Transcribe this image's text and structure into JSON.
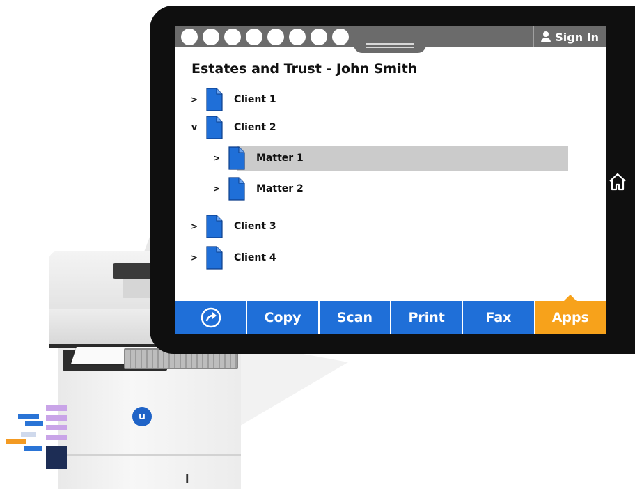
{
  "colors": {
    "accent": "#1f6fd8",
    "active_tab": "#f7a21b",
    "status_bar": "#6b6b6b",
    "selection": "#cbcbcb",
    "tablet_frame": "#0f0f0f"
  },
  "status_bar": {
    "dot_count": 8,
    "sign_in_label": "Sign In",
    "user_icon": "user-icon"
  },
  "page_title": "Estates and Trust - John Smith",
  "tree": [
    {
      "label": "Client 1",
      "chevron": ">",
      "level": 0,
      "selected": false
    },
    {
      "label": "Client 2",
      "chevron": "v",
      "level": 0,
      "selected": false
    },
    {
      "label": "Matter 1",
      "chevron": ">",
      "level": 1,
      "selected": true
    },
    {
      "label": "Matter 2",
      "chevron": ">",
      "level": 1,
      "selected": false
    },
    {
      "label": "Client 3",
      "chevron": ">",
      "level": 0,
      "selected": false
    },
    {
      "label": "Client 4",
      "chevron": ">",
      "level": 0,
      "selected": false
    }
  ],
  "nav": {
    "share_icon": "share-arrow-icon",
    "items": [
      "Copy",
      "Scan",
      "Print",
      "Fax",
      "Apps"
    ],
    "active": "Apps"
  },
  "side_button_icon": "home-icon",
  "printer": {
    "logo_letter": "u",
    "info_mark": "i"
  }
}
